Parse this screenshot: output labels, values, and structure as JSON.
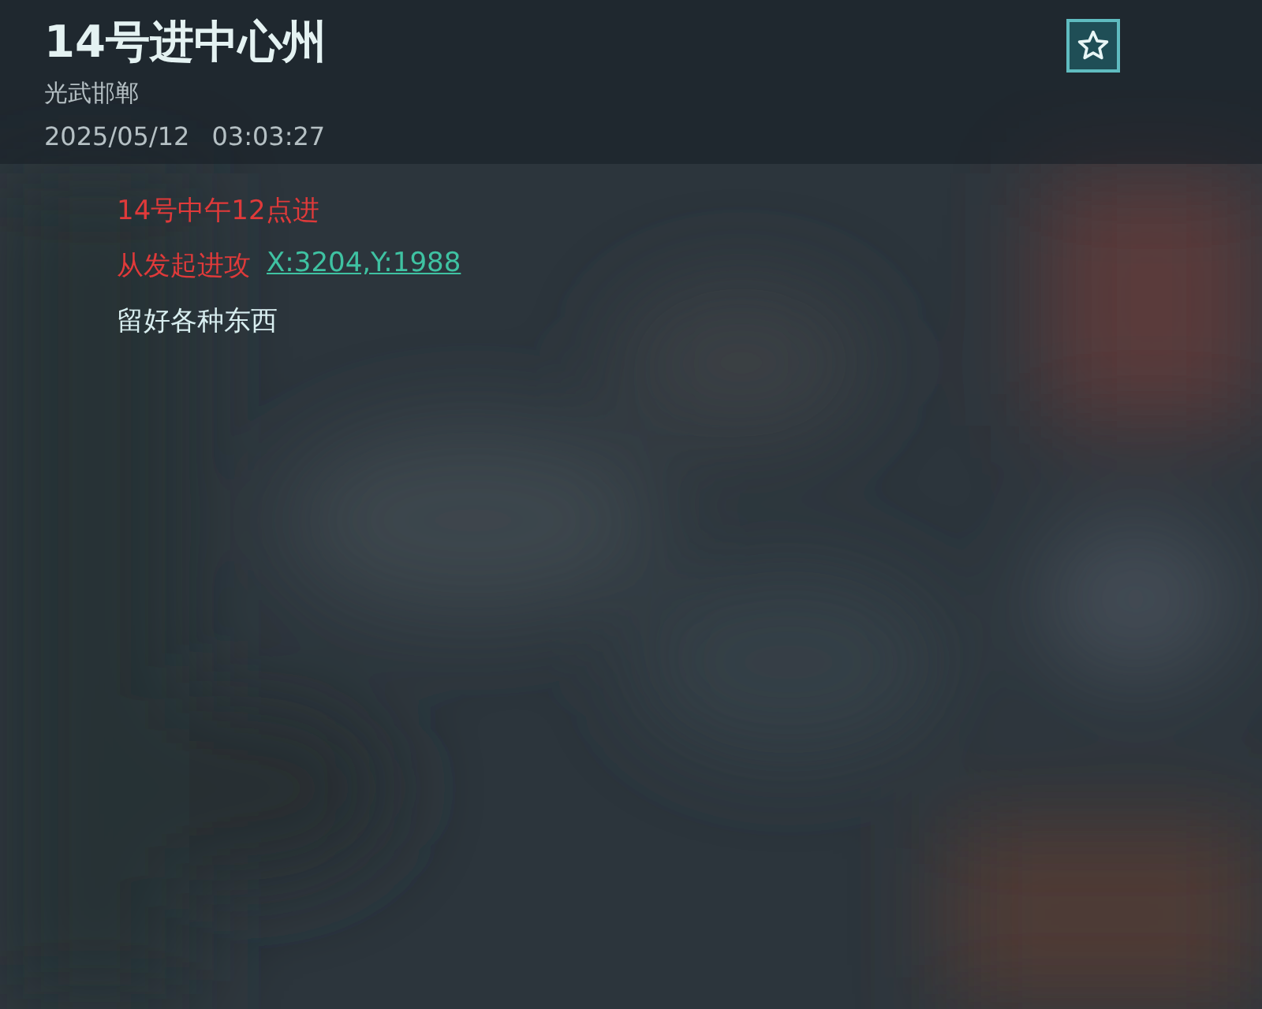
{
  "header": {
    "title": "14号进中心州",
    "location": "光武邯郸",
    "date": "2025/05/12",
    "time": "03:03:27"
  },
  "message": {
    "lines": [
      {
        "segments": [
          {
            "kind": "text",
            "text": "14号中午12点进",
            "color": "#e03a3a"
          }
        ]
      },
      {
        "segments": [
          {
            "kind": "text",
            "text": "从发起进攻",
            "color": "#e03a3a"
          },
          {
            "kind": "link",
            "text": "X:3204,Y:1988",
            "color": "#3fc2a2"
          }
        ]
      },
      {
        "segments": [
          {
            "kind": "text",
            "text": "留好各种东西",
            "color": "#d8eef0"
          }
        ]
      }
    ]
  }
}
